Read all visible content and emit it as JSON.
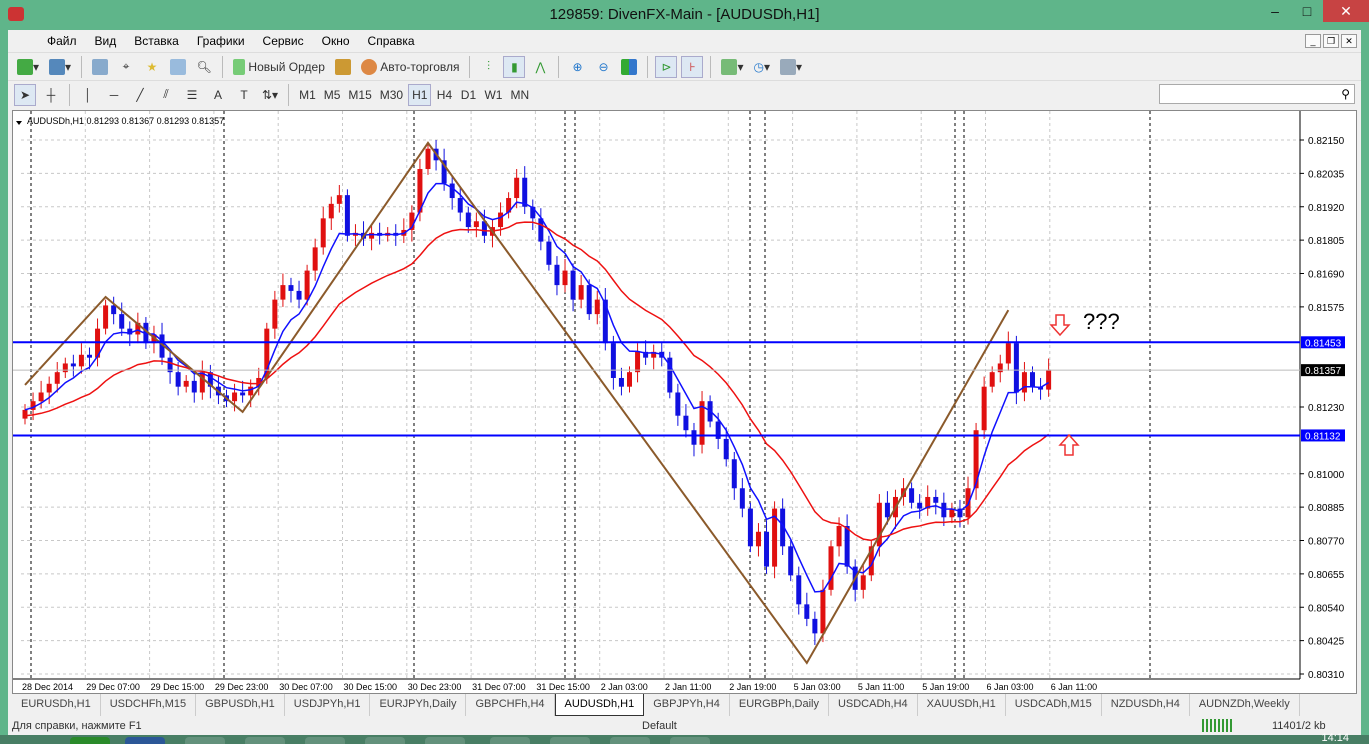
{
  "window": {
    "title": "129859: DivenFX-Main - [AUDUSDh,H1]"
  },
  "menu": [
    "Файл",
    "Вид",
    "Вставка",
    "Графики",
    "Сервис",
    "Окно",
    "Справка"
  ],
  "toolbar": {
    "new_order": "Новый Ордер",
    "auto_trading": "Авто-торговля"
  },
  "timeframes": [
    "M1",
    "M5",
    "M15",
    "M30",
    "H1",
    "H4",
    "D1",
    "W1",
    "MN"
  ],
  "active_timeframe": "H1",
  "chart": {
    "info": "AUDUSDh,H1  0.81293 0.81367 0.81293 0.81357",
    "annotation": "???"
  },
  "colors": {
    "bull": "#e01010",
    "bear": "#1010e0",
    "ma_fast": "#1010ff",
    "ma_slow": "#ee1111",
    "zigzag": "#8b5a2b",
    "level": "#0000ff",
    "arrow": "#e33"
  },
  "chart_data": {
    "type": "candlestick",
    "symbol": "AUDUSDh",
    "timeframe": "H1",
    "ylim": [
      0.8031,
      0.8215
    ],
    "y_ticks": [
      "0.82150",
      "0.82035",
      "0.81920",
      "0.81805",
      "0.81690",
      "0.81575",
      "0.81230",
      "0.81000",
      "0.80885",
      "0.80770",
      "0.80655",
      "0.80540",
      "0.80425",
      "0.80310"
    ],
    "x_ticks": [
      "28 Dec 2014",
      "29 Dec 07:00",
      "29 Dec 15:00",
      "29 Dec 23:00",
      "30 Dec 07:00",
      "30 Dec 15:00",
      "30 Dec 23:00",
      "31 Dec 07:00",
      "31 Dec 15:00",
      "2 Jan 03:00",
      "2 Jan 11:00",
      "2 Jan 19:00",
      "5 Jan 03:00",
      "5 Jan 11:00",
      "5 Jan 19:00",
      "6 Jan 03:00",
      "6 Jan 11:00"
    ],
    "closes": [
      0.8122,
      0.8125,
      0.8128,
      0.8131,
      0.8135,
      0.8138,
      0.8137,
      0.8141,
      0.814,
      0.815,
      0.8158,
      0.8155,
      0.815,
      0.8148,
      0.8152,
      0.8145,
      0.8148,
      0.814,
      0.8135,
      0.813,
      0.8132,
      0.8128,
      0.8135,
      0.813,
      0.8127,
      0.8125,
      0.8128,
      0.8127,
      0.813,
      0.8133,
      0.815,
      0.816,
      0.8165,
      0.8163,
      0.816,
      0.817,
      0.8178,
      0.8188,
      0.8193,
      0.8196,
      0.8182,
      0.8183,
      0.8181,
      0.8183,
      0.8182,
      0.8183,
      0.8182,
      0.8184,
      0.819,
      0.8205,
      0.8212,
      0.8208,
      0.82,
      0.8195,
      0.819,
      0.8185,
      0.8187,
      0.8182,
      0.8185,
      0.819,
      0.8195,
      0.8202,
      0.8192,
      0.8188,
      0.818,
      0.8172,
      0.8165,
      0.817,
      0.816,
      0.8165,
      0.8155,
      0.816,
      0.8145,
      0.8133,
      0.813,
      0.8135,
      0.8142,
      0.814,
      0.8142,
      0.814,
      0.8128,
      0.812,
      0.8115,
      0.811,
      0.8125,
      0.8118,
      0.8112,
      0.8105,
      0.8095,
      0.8088,
      0.8075,
      0.808,
      0.8068,
      0.8088,
      0.8075,
      0.8065,
      0.8055,
      0.805,
      0.8045,
      0.806,
      0.8075,
      0.8082,
      0.8068,
      0.806,
      0.8065,
      0.8075,
      0.809,
      0.8085,
      0.8092,
      0.8095,
      0.809,
      0.8088,
      0.8092,
      0.809,
      0.8085,
      0.8088,
      0.8085,
      0.8095,
      0.8115,
      0.813,
      0.8135,
      0.8138,
      0.8145,
      0.8128,
      0.8135,
      0.813,
      0.8129,
      0.81357
    ],
    "zigzag": [
      [
        0,
        0.81306
      ],
      [
        10,
        0.81609
      ],
      [
        27,
        0.81213
      ],
      [
        50,
        0.8214
      ],
      [
        97,
        0.80348
      ],
      [
        122,
        0.81564
      ]
    ],
    "levels": [
      "0.81453",
      "0.81132"
    ],
    "current_price": "0.81357"
  },
  "tabs": [
    "EURUSDh,H1",
    "USDCHFh,M15",
    "GBPUSDh,H1",
    "USDJPYh,H1",
    "EURJPYh,Daily",
    "GBPCHFh,H4",
    "AUDUSDh,H1",
    "GBPJPYh,H4",
    "EURGBPh,Daily",
    "USDCADh,H4",
    "XAUUSDh,H1",
    "USDCADh,M15",
    "NZDUSDh,H4",
    "AUDNZDh,Weekly"
  ],
  "active_tab": "AUDUSDh,H1",
  "status": {
    "help": "Для справки, нажмите F1",
    "profile": "Default",
    "traffic": "11401/2 kb"
  },
  "taskbar": {
    "clock": "14:14"
  }
}
